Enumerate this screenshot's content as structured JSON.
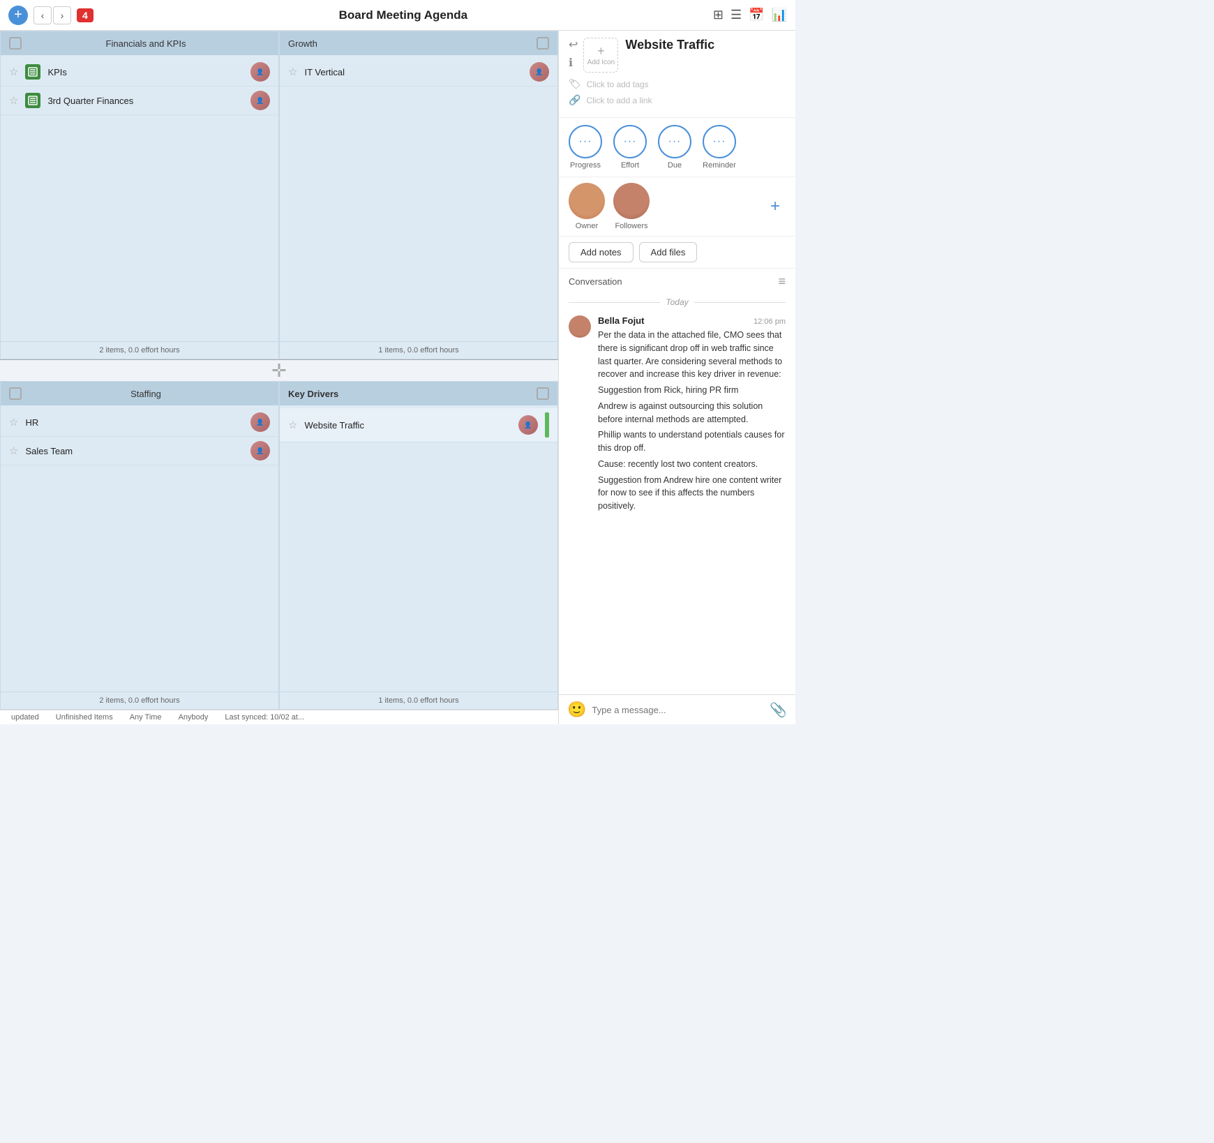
{
  "toolbar": {
    "add_label": "+",
    "nav_back": "‹",
    "nav_forward": "›",
    "badge": "4",
    "title": "Board Meeting Agenda",
    "view_icons": [
      "⊞",
      "≡",
      "📅",
      "📊"
    ]
  },
  "board": {
    "sections": [
      {
        "id": "financials",
        "header": "Financials and KPIs",
        "items": [
          {
            "label": "KPIs",
            "starred": false
          },
          {
            "label": "3rd Quarter Finances",
            "starred": false
          }
        ],
        "footer": "2 items, 0.0 effort hours"
      },
      {
        "id": "growth",
        "header": "Growth",
        "items": [
          {
            "label": "IT Vertical",
            "starred": false
          }
        ],
        "footer": "1 items, 0.0 effort hours"
      },
      {
        "id": "staffing",
        "header": "Staffing",
        "items": [
          {
            "label": "HR",
            "starred": false
          },
          {
            "label": "Sales Team",
            "starred": false
          }
        ],
        "footer": "2 items, 0.0 effort hours"
      },
      {
        "id": "key_drivers",
        "header": "Key Drivers",
        "bold": true,
        "items": [
          {
            "label": "Website Traffic",
            "starred": false,
            "selected": true,
            "progress_bar": true
          }
        ],
        "footer": "1 items, 0.0 effort hours"
      }
    ]
  },
  "right_panel": {
    "title": "Website Traffic",
    "add_icon_label": "Add Icon",
    "tags_placeholder": "Click to add tags",
    "link_placeholder": "Click to add a link",
    "fields": [
      {
        "label": "Progress"
      },
      {
        "label": "Effort"
      },
      {
        "label": "Due"
      },
      {
        "label": "Reminder"
      }
    ],
    "people": [
      {
        "label": "Owner"
      },
      {
        "label": "Followers"
      }
    ],
    "add_notes_label": "Add notes",
    "add_files_label": "Add files",
    "conversation_title": "Conversation",
    "today_label": "Today",
    "messages": [
      {
        "author": "Bella Fojut",
        "time": "12:06 pm",
        "paragraphs": [
          "Per the data in the attached file, CMO sees that there is significant drop off in web traffic since last quarter. Are considering several methods to recover and increase this key driver in revenue:",
          "Suggestion from Rick, hiring PR firm",
          "Andrew is against outsourcing this solution before internal methods are attempted.",
          "Phillip wants to understand potentials causes for this drop off.",
          "Cause: recently lost two content creators.",
          "Suggestion from Andrew hire one content writer for now to see if this affects the numbers positively."
        ]
      }
    ]
  },
  "status_bar": {
    "items": [
      "updated",
      "Unfinished Items",
      "Any Time",
      "Anybody",
      "Last synced: 10/02 at..."
    ]
  }
}
